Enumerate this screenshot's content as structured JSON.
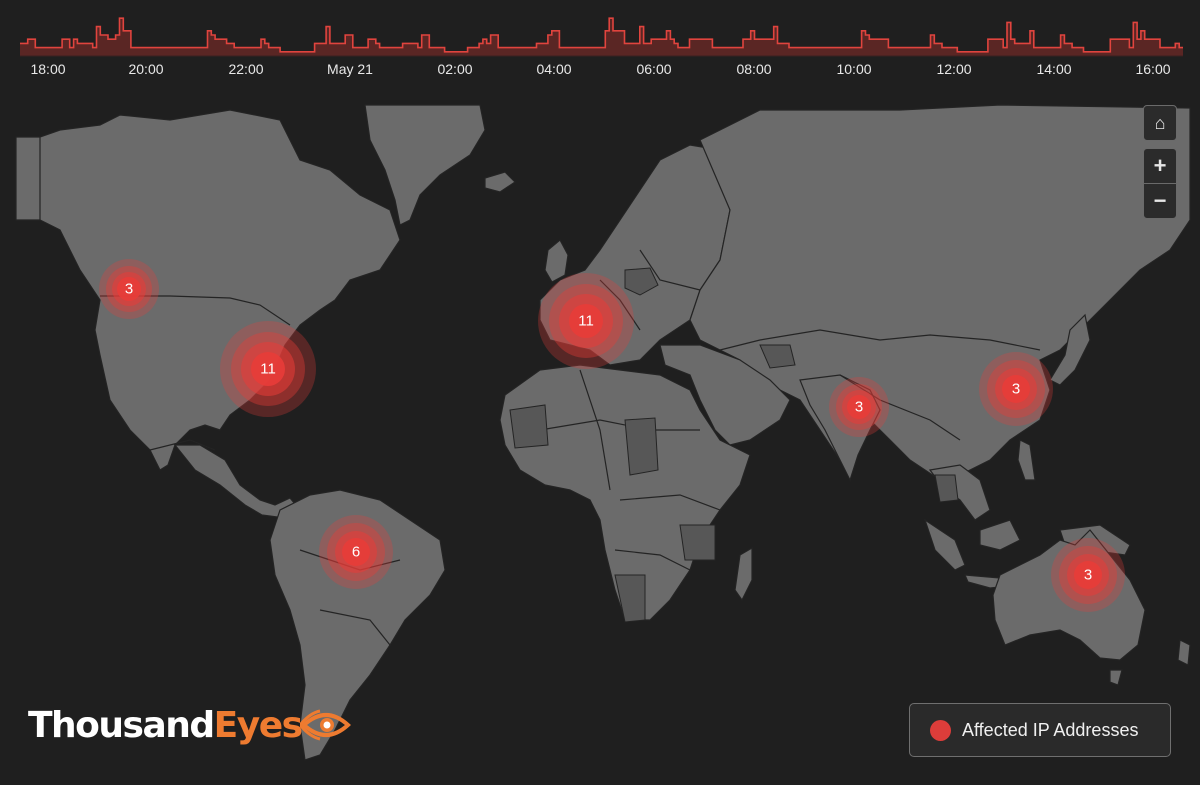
{
  "timeline": {
    "tick_labels": [
      "18:00",
      "20:00",
      "22:00",
      "May 21",
      "02:00",
      "04:00",
      "06:00",
      "08:00",
      "10:00",
      "12:00",
      "14:00",
      "16:00"
    ],
    "series_color": "#e0443e",
    "fill_color": "#5a2624",
    "max_value": 10,
    "values": [
      3,
      3,
      4,
      4,
      2,
      2,
      2,
      2,
      2,
      2,
      2,
      4,
      4,
      2,
      4,
      3,
      3,
      3,
      3,
      2,
      7,
      5,
      5,
      4,
      4,
      5,
      9,
      6,
      6,
      2,
      2,
      2,
      2,
      2,
      2,
      2,
      2,
      2,
      2,
      2,
      2,
      2,
      2,
      2,
      2,
      2,
      2,
      2,
      2,
      6,
      5,
      4,
      4,
      4,
      3,
      3,
      2,
      2,
      2,
      2,
      2,
      2,
      2,
      4,
      3,
      2,
      2,
      2,
      1,
      1,
      1,
      1,
      1,
      1,
      1,
      1,
      1,
      3,
      3,
      3,
      7,
      3,
      3,
      3,
      3,
      5,
      5,
      2,
      2,
      2,
      2,
      4,
      4,
      3,
      2,
      2,
      2,
      2,
      2,
      2,
      3,
      3,
      3,
      3,
      2,
      5,
      5,
      2,
      2,
      2,
      2,
      1,
      1,
      1,
      1,
      1,
      1,
      2,
      2,
      2,
      3,
      4,
      3,
      5,
      5,
      2,
      2,
      2,
      2,
      2,
      2,
      2,
      2,
      2,
      2,
      3,
      3,
      3,
      5,
      6,
      6,
      2,
      2,
      2,
      2,
      2,
      2,
      2,
      2,
      2,
      2,
      2,
      2,
      6,
      9,
      6,
      6,
      6,
      3,
      3,
      3,
      3,
      7,
      3,
      3,
      4,
      4,
      4,
      4,
      6,
      4,
      3,
      2,
      2,
      2,
      4,
      4,
      4,
      4,
      4,
      4,
      2,
      2,
      2,
      2,
      2,
      2,
      2,
      2,
      4,
      4,
      6,
      4,
      4,
      4,
      4,
      4,
      7,
      3,
      3,
      3,
      2,
      2,
      2,
      2,
      2,
      2,
      2,
      2,
      2,
      2,
      2,
      2,
      2,
      2,
      2,
      2,
      2,
      2,
      2,
      6,
      5,
      4,
      4,
      4,
      4,
      4,
      2,
      2,
      2,
      2,
      2,
      2,
      2,
      2,
      2,
      2,
      2,
      5,
      3,
      3,
      2,
      2,
      2,
      2,
      1,
      1,
      1,
      1,
      1,
      1,
      1,
      1,
      4,
      4,
      4,
      4,
      2,
      8,
      4,
      3,
      3,
      3,
      3,
      6,
      2,
      2,
      2,
      2,
      2,
      2,
      2,
      5,
      3,
      3,
      2,
      2,
      2,
      1,
      1,
      1,
      1,
      1,
      1,
      1,
      4,
      4,
      4,
      4,
      4,
      2,
      8,
      4,
      6,
      4,
      4,
      4,
      4,
      2,
      2,
      2,
      2,
      3,
      2
    ]
  },
  "map": {
    "land_color": "#6b6b6b",
    "land_alt_color": "#575757",
    "water_color": "#1f1f1f",
    "border_color": "#242424",
    "clusters": [
      {
        "id": "us-west",
        "count": "3",
        "size": "small"
      },
      {
        "id": "us-east",
        "count": "11",
        "size": "large"
      },
      {
        "id": "europe",
        "count": "11",
        "size": "large"
      },
      {
        "id": "india",
        "count": "3",
        "size": "small"
      },
      {
        "id": "china",
        "count": "3",
        "size": "medium"
      },
      {
        "id": "brazil",
        "count": "6",
        "size": "medium"
      },
      {
        "id": "australia",
        "count": "3",
        "size": "medium"
      }
    ]
  },
  "controls": {
    "home_icon": "⌂",
    "zoom_in_label": "+",
    "zoom_out_label": "−"
  },
  "logo": {
    "part1": "Thousand",
    "part2": "Eyes",
    "accent": "#ee7b30"
  },
  "legend": {
    "label": "Affected IP Addresses",
    "dot_color": "#dc3d3a"
  }
}
